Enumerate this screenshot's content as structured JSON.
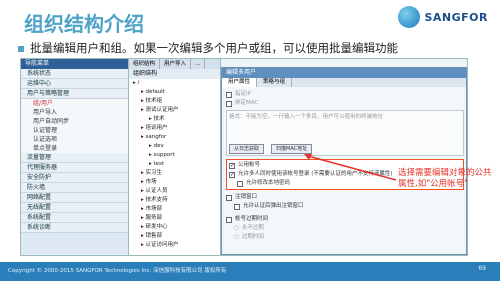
{
  "slide": {
    "title": "组织结构介绍",
    "description": "批量编辑用户和组。如果一次编辑多个用户或组，可以使用批量编辑功能",
    "brand": "SANGFOR",
    "copyright": "Copyright © 2000-2015 SANGFOR Technologies Inc. 深信服科技有限公司 版权所有",
    "page_number": "69",
    "callout": "选择需要编辑对象的公共属性,如\"公用帐号\""
  },
  "nav": {
    "header": "导航菜单",
    "items": [
      {
        "label": "系统状态"
      },
      {
        "label": "运维中心"
      },
      {
        "label": "用户与策略管理"
      }
    ],
    "sub_items": [
      {
        "label": "组/用户",
        "active": true
      },
      {
        "label": "用户导入",
        "active": false
      },
      {
        "label": "用户自动同步",
        "active": false
      }
    ],
    "items2": [
      {
        "label": "认证管理"
      },
      {
        "label": "认证选项"
      },
      {
        "label": "单点登录"
      },
      {
        "label": "流量管理"
      },
      {
        "label": "代理服务器"
      },
      {
        "label": "安全防护"
      },
      {
        "label": "防火墙"
      },
      {
        "label": "网络配置"
      },
      {
        "label": "无线配置"
      },
      {
        "label": "系统配置"
      },
      {
        "label": "系统诊断"
      }
    ]
  },
  "tree": {
    "tabs": [
      "组织结构",
      "用户导入",
      "..."
    ],
    "header": "组织结构",
    "items": [
      "/",
      "default",
      "技术组",
      "测试认证用户",
      "技术",
      "培训用户",
      "sangfor",
      "dev",
      "support",
      "test",
      "实习生",
      "市场",
      "认证人员",
      "技术支持",
      "市场部",
      "服务部",
      "研发中心",
      "销售部",
      "认证访问用户"
    ]
  },
  "dialog": {
    "title": "编辑多用户",
    "tabs": [
      "用户属性",
      "策略与组"
    ],
    "rows": [
      {
        "label": "指定IP",
        "checked": false,
        "grey": true
      },
      {
        "label": "绑定MAC",
        "checked": false,
        "grey": true
      },
      {
        "label": "格式：不能为空，一行输入一个条目，用户可以使用的终端地址",
        "checked": false,
        "grey": true
      }
    ],
    "buttons": [
      "从日志获取",
      "扫描MAC地址"
    ],
    "highlight": {
      "label1": "公用帐号",
      "label2": "允许多人同时使用该帐号登录 (不需要认证的用户不支持该属性)",
      "label3": "允许修改本地密码"
    },
    "rows2": [
      {
        "label": "注销窗口",
        "checked": false
      },
      {
        "label": "允许认证后弹出注销窗口",
        "checked": false
      },
      {
        "label": "帐号过期时间",
        "checked": false
      },
      {
        "label": "永不过期",
        "checked": false
      },
      {
        "label": "过期时间",
        "checked": false
      }
    ]
  },
  "colors": {
    "title": "#4fa3c8",
    "callout": "#e5332a",
    "footer": "#2a7fba"
  }
}
